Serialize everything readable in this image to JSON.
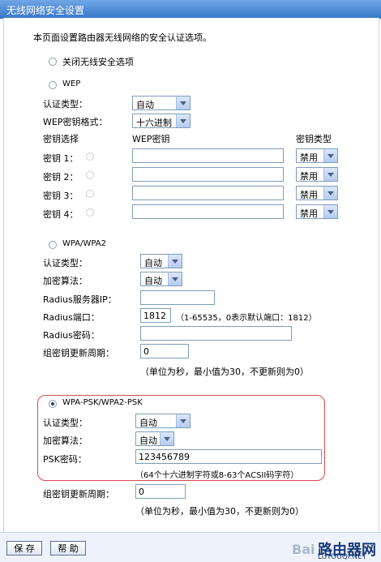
{
  "window": {
    "title": "无线网络安全设置"
  },
  "intro": "本页面设置路由器无线网络的安全认证选项。",
  "options": {
    "off": "关闭无线安全选项",
    "wep": "WEP",
    "wpa": "WPA/WPA2",
    "wpapsk": "WPA-PSK/WPA2-PSK"
  },
  "wep": {
    "auth_type_label": "认证类型：",
    "auth_type_value": "自动",
    "key_format_label": "WEP密钥格式：",
    "key_format_value": "十六进制",
    "col_select": "密钥选择",
    "col_key": "WEP密钥",
    "col_type": "密钥类型",
    "keys": [
      {
        "label": "密钥 1：",
        "type": "禁用"
      },
      {
        "label": "密钥 2：",
        "type": "禁用"
      },
      {
        "label": "密钥 3：",
        "type": "禁用"
      },
      {
        "label": "密钥 4：",
        "type": "禁用"
      }
    ]
  },
  "wpa": {
    "auth_type_label": "认证类型：",
    "auth_type_value": "自动",
    "encrypt_label": "加密算法：",
    "encrypt_value": "自动",
    "radius_ip_label": "Radius服务器IP：",
    "radius_port_label": "Radius端口：",
    "radius_port_value": "1812",
    "radius_port_hint": "（1-65535，0表示默认端口：1812）",
    "radius_pwd_label": "Radius密码：",
    "group_key_label": "组密钥更新周期：",
    "group_key_value": "0",
    "group_key_hint": "（单位为秒，最小值为30，不更新则为0）"
  },
  "wpapsk": {
    "auth_type_label": "认证类型：",
    "auth_type_value": "自动",
    "encrypt_label": "加密算法：",
    "encrypt_value": "自动",
    "psk_label": "PSK密码：",
    "psk_value": "123456789",
    "psk_hint": "（64个十六进制字符或8-63个ACSII码字符）",
    "group_key_label": "组密钥更新周期：",
    "group_key_value": "0",
    "group_key_hint": "（单位为秒，最小值为30，不更新则为0）"
  },
  "buttons": {
    "save": "保 存",
    "help": "帮 助"
  },
  "watermark": {
    "left": "Bai",
    "brand": "路由器网",
    "url": "LUYOUQI.NET"
  }
}
